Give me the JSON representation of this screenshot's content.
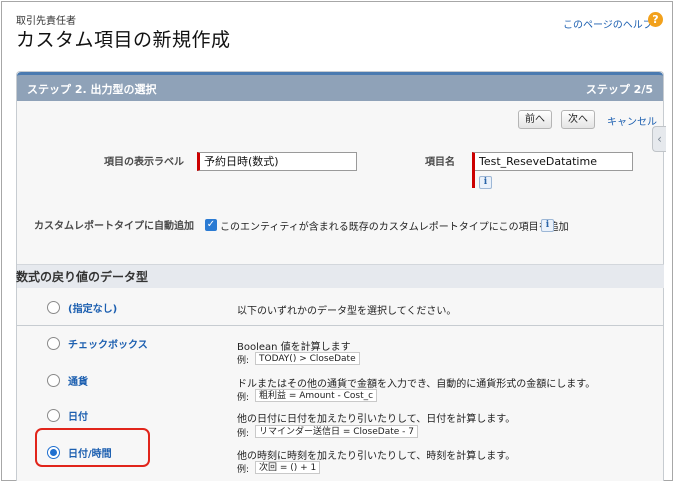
{
  "header": {
    "object_label": "取引先責任者",
    "title": "カスタム項目の新規作成",
    "help_link": "このページのヘルプ",
    "help_icon": "?"
  },
  "section": {
    "step_title": "ステップ 2. 出力型の選択",
    "step_count": "ステップ 2/5"
  },
  "buttons": {
    "prev": "前へ",
    "next": "次へ",
    "cancel": "キャンセル"
  },
  "fields": {
    "display_label_caption": "項目の表示ラベル",
    "display_label_value": "予約日時(数式)",
    "field_name_caption": "項目名",
    "field_name_value": "Test_ReseveDatatime",
    "info_icon": "i",
    "auto_add_caption": "カスタムレポートタイプに自動追加",
    "auto_add_text": "このエンティティが含まれる既存のカスタムレポートタイプにこの項目を追加",
    "auto_add_checked": true
  },
  "data_type": {
    "title": "数式の戻り値のデータ型",
    "example_prefix": "例:",
    "options": [
      {
        "label": "(指定なし)",
        "description": "以下のいずれかのデータ型を選択してください。",
        "example": "",
        "selected": false
      },
      {
        "label": "チェックボックス",
        "description": "Boolean 値を計算します",
        "example": "TODAY() > CloseDate",
        "selected": false
      },
      {
        "label": "通貨",
        "description": "ドルまたはその他の通貨で金額を入力でき、自動的に通貨形式の金額にします。",
        "example": "粗利益 = Amount - Cost_c",
        "selected": false
      },
      {
        "label": "日付",
        "description": "他の日付に日付を加えたり引いたりして、日付を計算します。",
        "example": "リマインダー送信日 = CloseDate - 7",
        "selected": false
      },
      {
        "label": "日付/時間",
        "description": "他の時刻に時刻を加えたり引いたりして、時刻を計算します。",
        "example": "次回 = () + 1",
        "selected": true
      }
    ]
  },
  "colors": {
    "header_band": "#8fa2b8",
    "link": "#1c5fb0",
    "highlight": "#e1251b",
    "required": "#cc0000"
  }
}
